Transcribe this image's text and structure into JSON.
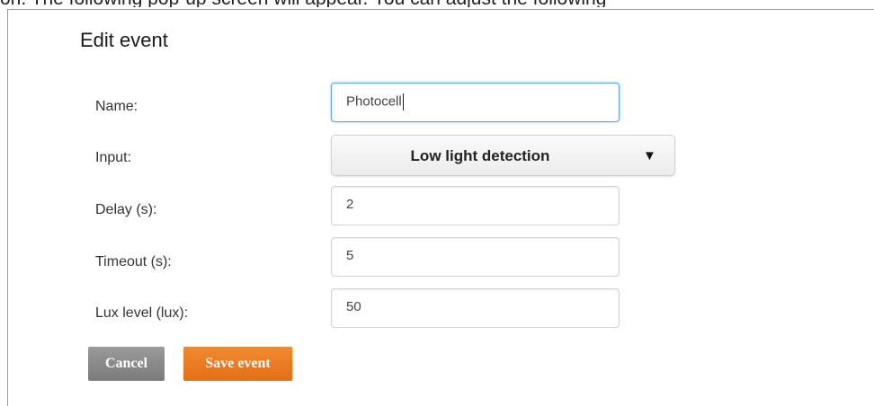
{
  "page_context": {
    "top_cut_text": "on. The following pop-up screen will appear. You can adjust the following"
  },
  "dialog": {
    "title": "Edit event",
    "fields": {
      "name": {
        "label": "Name:",
        "value": "Photocell"
      },
      "input": {
        "label": "Input:",
        "selected": "Low light detection",
        "arrow_icon": "triangle-down"
      },
      "delay": {
        "label": "Delay (s):",
        "value": "2"
      },
      "timeout": {
        "label": "Timeout (s):",
        "value": "5"
      },
      "lux": {
        "label": "Lux level (lux):",
        "value": "50"
      }
    },
    "buttons": {
      "cancel": "Cancel",
      "save": "Save event"
    }
  },
  "colors": {
    "save_button": "#e8781e",
    "cancel_button": "#8a8a8a",
    "focus_border": "#5aa7e6"
  }
}
